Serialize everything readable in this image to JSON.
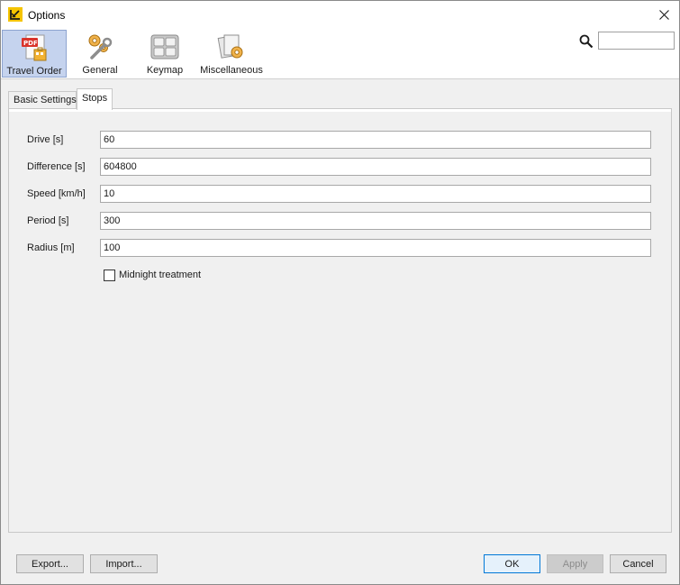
{
  "window": {
    "title": "Options"
  },
  "toolbar": {
    "items": [
      {
        "label": "Travel Order",
        "icon": "pdf-document-icon",
        "selected": true
      },
      {
        "label": "General",
        "icon": "gears-wrench-icon",
        "selected": false
      },
      {
        "label": "Keymap",
        "icon": "keyboard-keys-icon",
        "selected": false
      },
      {
        "label": "Miscellaneous",
        "icon": "documents-gear-icon",
        "selected": false
      }
    ],
    "search": {
      "value": "",
      "icon": "search-icon"
    }
  },
  "tabs": [
    {
      "label": "Basic Settings",
      "active": false
    },
    {
      "label": "Stops",
      "active": true
    }
  ],
  "form": {
    "fields": [
      {
        "label": "Drive [s]",
        "value": "60"
      },
      {
        "label": "Difference [s]",
        "value": "604800"
      },
      {
        "label": "Speed [km/h]",
        "value": "10"
      },
      {
        "label": "Period [s]",
        "value": "300"
      },
      {
        "label": "Radius [m]",
        "value": "100"
      }
    ],
    "midnight": {
      "label": "Midnight treatment",
      "checked": false
    }
  },
  "buttons": {
    "export": "Export...",
    "import": "Import...",
    "ok": "OK",
    "apply": "Apply",
    "cancel": "Cancel"
  },
  "colors": {
    "accent": "#0078d7",
    "selected_bg": "#c5d3ee",
    "app_icon_yellow": "#f5c400"
  }
}
